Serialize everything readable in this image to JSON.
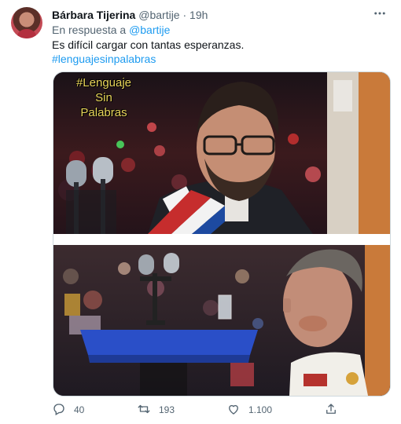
{
  "tweet": {
    "author_name": "Bárbara Tijerina",
    "author_handle": "@bartije",
    "time": "19h",
    "reply_prefix": "En respuesta a",
    "reply_to": "@bartije",
    "text": "Es difícil cargar con tantas esperanzas.",
    "hashtag": "#lenguajesinpalabras"
  },
  "media": {
    "caption_line1": "#Lenguaje",
    "caption_line2": "Sin",
    "caption_line3": "Palabras"
  },
  "actions": {
    "replies": "40",
    "retweets": "193",
    "likes": "1.100"
  },
  "icons": {
    "more": "more-icon",
    "reply": "reply-icon",
    "retweet": "retweet-icon",
    "like": "heart-icon",
    "share": "share-icon"
  },
  "colors": {
    "accent": "#1d9bf0",
    "muted": "#536471"
  }
}
